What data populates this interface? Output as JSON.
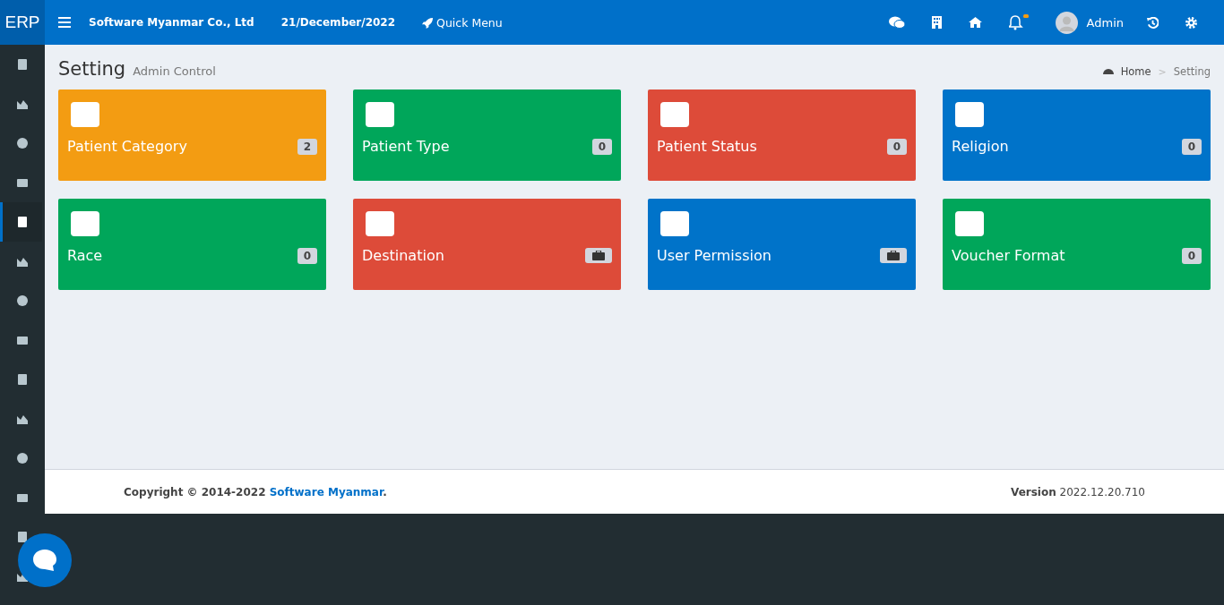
{
  "brand": "ERP",
  "topbar": {
    "company": "Software Myanmar Co., Ltd",
    "date": "21/December/2022",
    "quick_menu": "Quick Menu",
    "user": "Admin"
  },
  "sidebar": {
    "items": [
      {
        "selected": false
      },
      {
        "selected": false
      },
      {
        "selected": false
      },
      {
        "selected": false
      },
      {
        "selected": true
      },
      {
        "selected": false
      },
      {
        "selected": false
      },
      {
        "selected": false
      },
      {
        "selected": false
      },
      {
        "selected": false
      },
      {
        "selected": false
      },
      {
        "selected": false
      },
      {
        "selected": false
      },
      {
        "selected": false
      }
    ]
  },
  "header": {
    "title": "Setting",
    "subtitle": "Admin Control",
    "breadcrumb": [
      "Home",
      "Setting"
    ],
    "breadcrumb_separator": ">"
  },
  "tiles": [
    {
      "title": "Patient Category",
      "color": "#f39c12",
      "badge": {
        "kind": "count",
        "text": "2"
      }
    },
    {
      "title": "Patient Type",
      "color": "#00a65a",
      "badge": {
        "kind": "count",
        "text": "0"
      }
    },
    {
      "title": "Patient Status",
      "color": "#dd4b39",
      "badge": {
        "kind": "count",
        "text": "0"
      }
    },
    {
      "title": "Religion",
      "color": "#0073c9",
      "badge": {
        "kind": "count",
        "text": "0"
      }
    },
    {
      "title": "Race",
      "color": "#00a65a",
      "badge": {
        "kind": "count",
        "text": "0"
      }
    },
    {
      "title": "Destination",
      "color": "#dd4b39",
      "badge": {
        "kind": "briefcase"
      }
    },
    {
      "title": "User Permission",
      "color": "#0073c9",
      "badge": {
        "kind": "briefcase"
      }
    },
    {
      "title": "Voucher Format",
      "color": "#00a65a",
      "badge": {
        "kind": "count",
        "text": "0"
      }
    }
  ],
  "footer": {
    "copyright": "Copyright © 2014-2022",
    "link": "Software Myanmar",
    "suffix": ".",
    "version": "**Version** 2022.12.20.710"
  }
}
